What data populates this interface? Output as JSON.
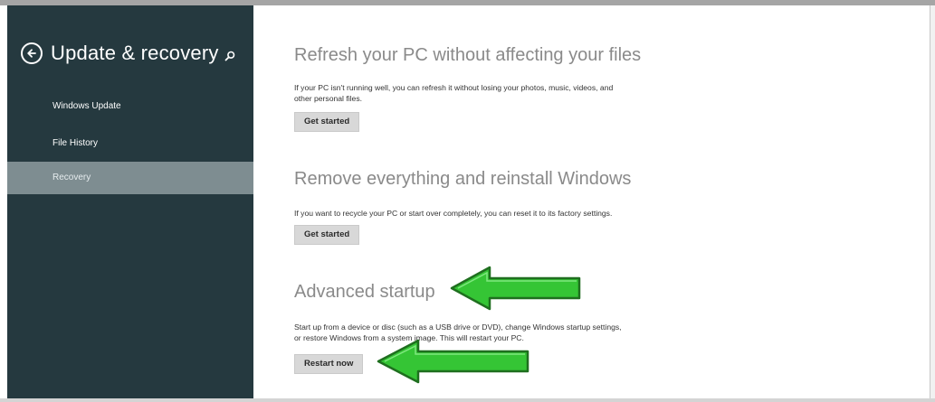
{
  "sidebar": {
    "title": "Update & recovery",
    "items": [
      {
        "label": "Windows Update",
        "active": false
      },
      {
        "label": "File History",
        "active": false
      },
      {
        "label": "Recovery",
        "active": true
      }
    ]
  },
  "sections": [
    {
      "title": "Refresh your PC without affecting your files",
      "desc_line1": "If your PC isn't running well, you can refresh it without losing your photos, music, videos, and",
      "desc_line2": "other personal files.",
      "button": "Get started"
    },
    {
      "title": "Remove everything and reinstall Windows",
      "desc_line1": "If you want to recycle your PC or start over completely, you can reset it to its factory settings.",
      "desc_line2": "",
      "button": "Get started"
    },
    {
      "title": "Advanced startup",
      "desc_line1": "Start up from a device or disc (such as a USB drive or DVD), change Windows startup settings,",
      "desc_line2": "or restore Windows from a system image. This will restart your PC.",
      "button": "Restart now"
    }
  ],
  "colors": {
    "sidebar_bg": "#25393f",
    "sidebar_active": "#7e8d91",
    "arrow_green": "#35c535"
  },
  "icons": {
    "back": "back-arrow-circle-icon",
    "search": "search-icon",
    "annotation": "green-arrow-icon"
  }
}
